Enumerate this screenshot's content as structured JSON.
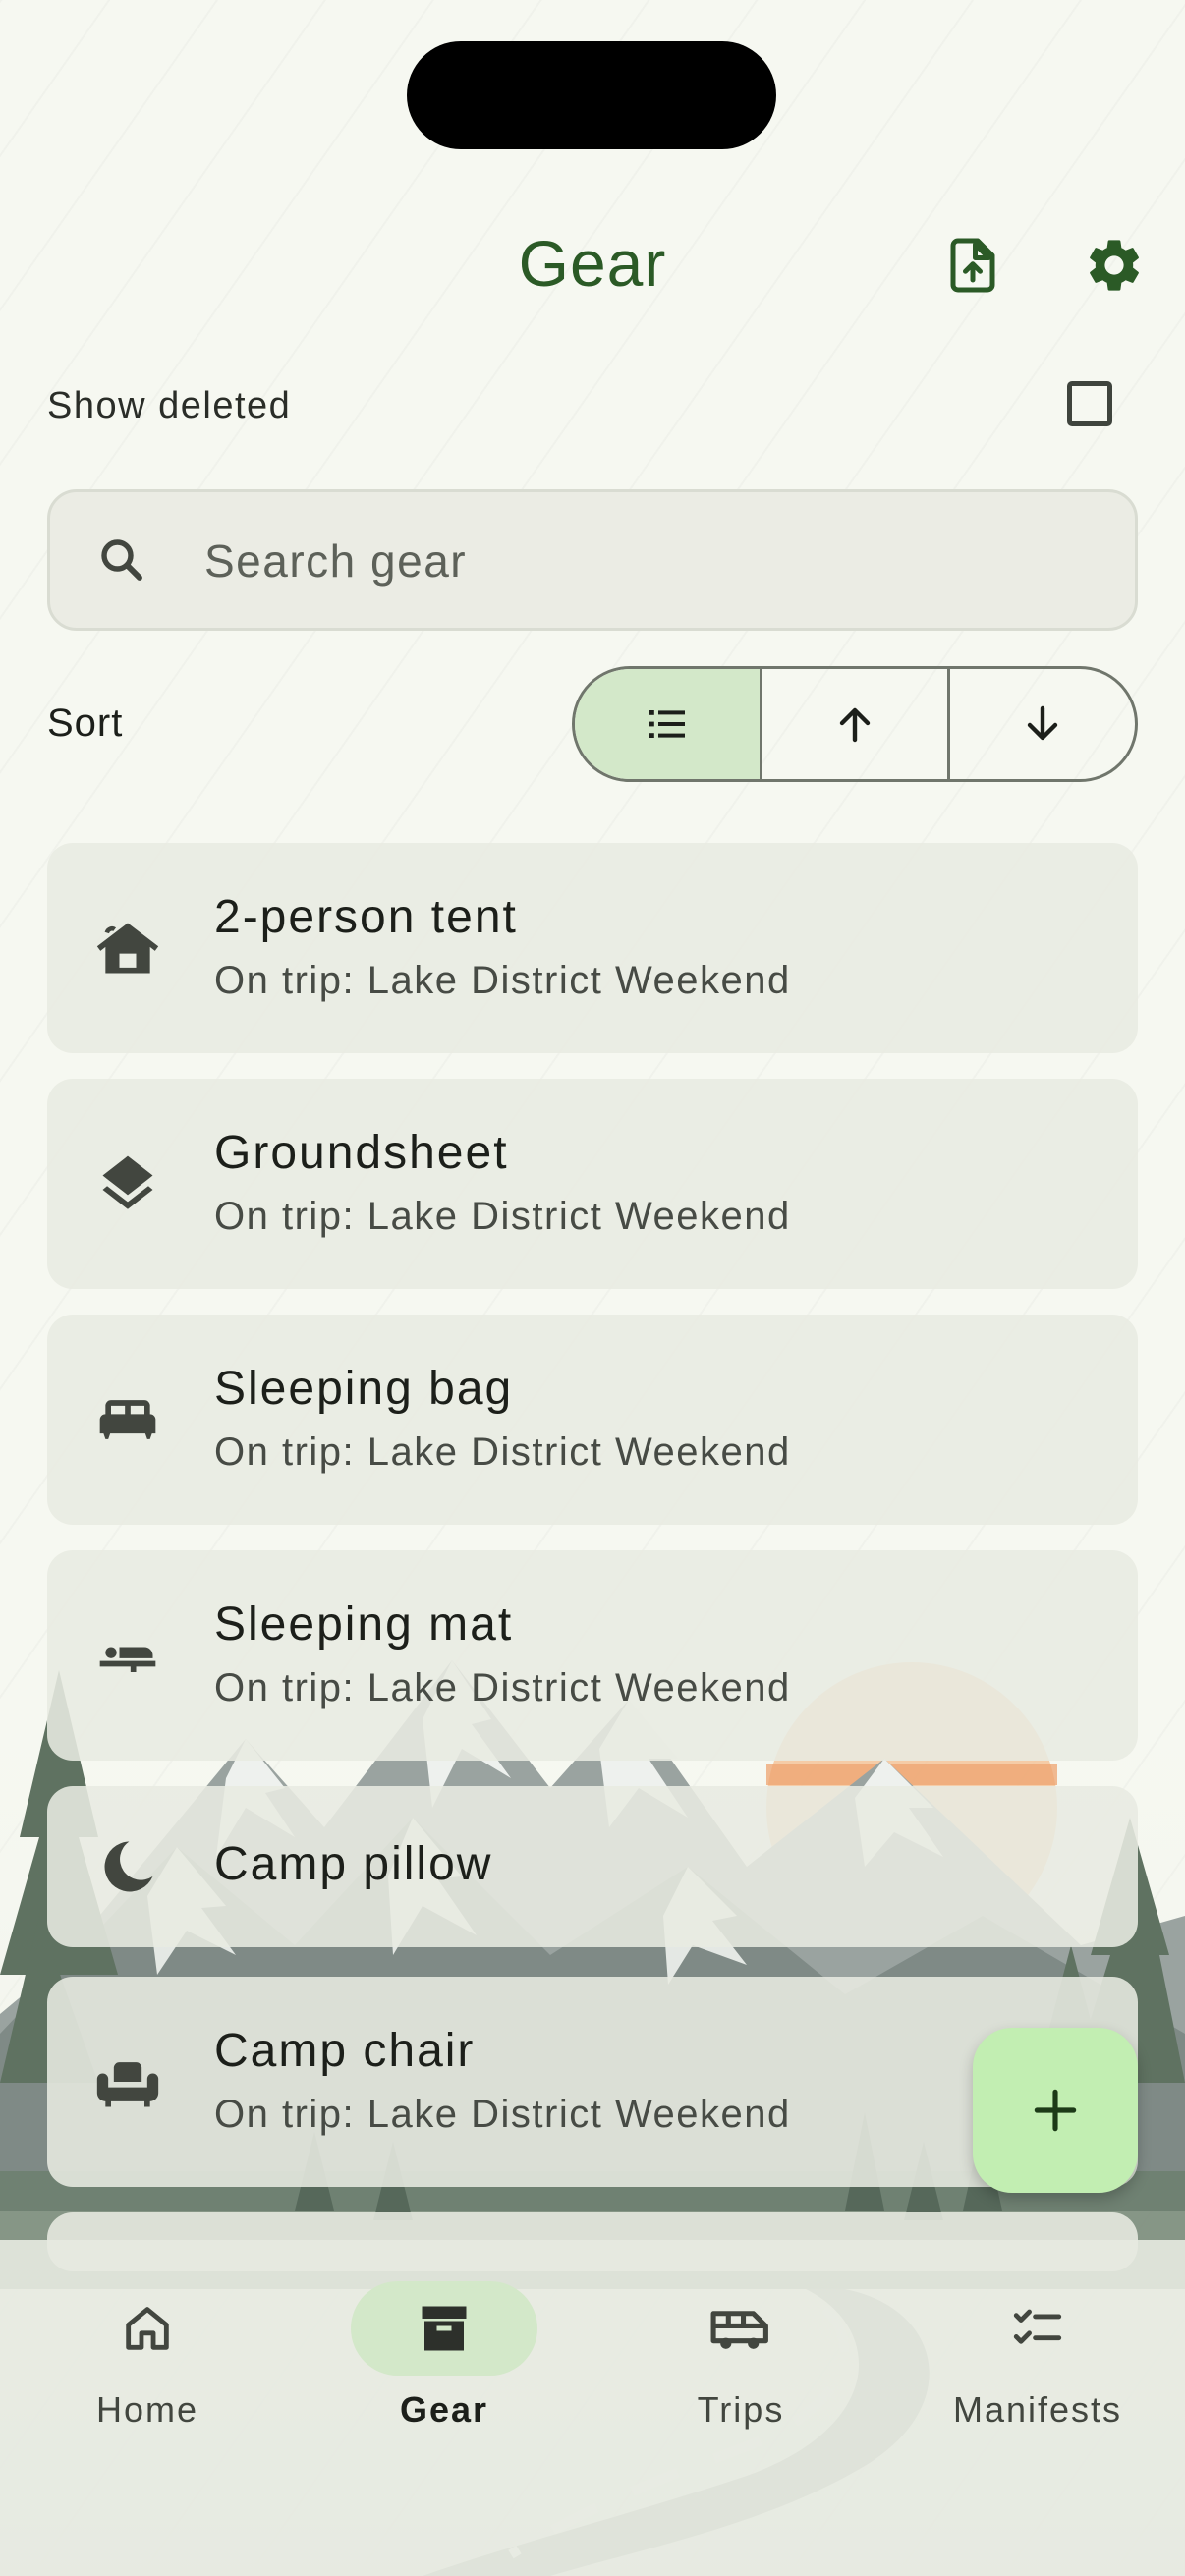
{
  "header": {
    "title": "Gear",
    "export_icon": "file-upload-icon",
    "settings_icon": "gear-icon"
  },
  "filters": {
    "show_deleted_label": "Show deleted",
    "show_deleted_checked": false
  },
  "search": {
    "placeholder": "Search gear",
    "value": ""
  },
  "sort": {
    "label": "Sort",
    "options": [
      {
        "icon": "list-icon",
        "selected": true
      },
      {
        "icon": "arrow-up-icon",
        "selected": false
      },
      {
        "icon": "arrow-down-icon",
        "selected": false
      }
    ]
  },
  "gear_items": [
    {
      "name": "2-person tent",
      "subtitle": "On trip: Lake District Weekend",
      "icon": "cabin-icon"
    },
    {
      "name": "Groundsheet",
      "subtitle": "On trip: Lake District Weekend",
      "icon": "layers-icon"
    },
    {
      "name": "Sleeping bag",
      "subtitle": "On trip: Lake District Weekend",
      "icon": "bed-icon"
    },
    {
      "name": "Sleeping mat",
      "subtitle": "On trip: Lake District Weekend",
      "icon": "hotel-icon"
    },
    {
      "name": "Camp pillow",
      "subtitle": "",
      "icon": "moon-icon"
    },
    {
      "name": "Camp chair",
      "subtitle": "On trip: Lake District Weekend",
      "icon": "chair-icon"
    }
  ],
  "fab": {
    "icon": "plus-icon"
  },
  "nav": {
    "items": [
      {
        "label": "Home",
        "icon": "home-icon",
        "active": false
      },
      {
        "label": "Gear",
        "icon": "inventory-box-icon",
        "active": true
      },
      {
        "label": "Trips",
        "icon": "van-icon",
        "active": false
      },
      {
        "label": "Manifests",
        "icon": "checklist-icon",
        "active": false
      }
    ]
  },
  "colors": {
    "primary": "#2b5a26",
    "active_container": "#d3e8c9",
    "fab": "#c2eeb2",
    "sun": "#f4c49a"
  }
}
